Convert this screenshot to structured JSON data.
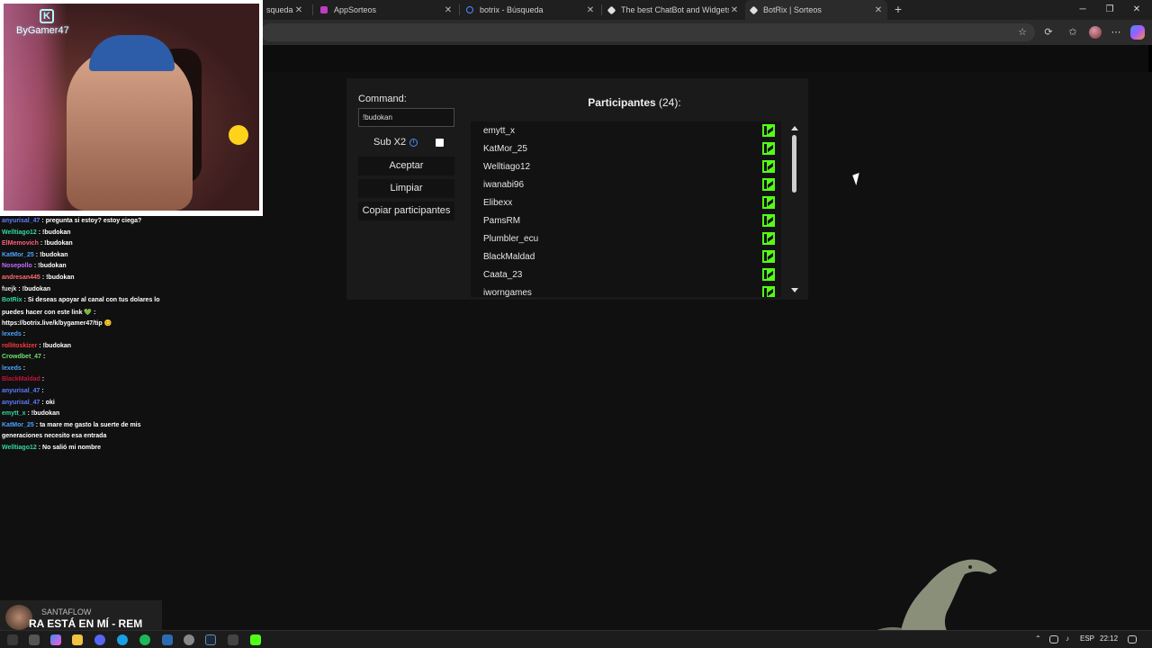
{
  "browser": {
    "tabs": [
      {
        "label": "squeda",
        "favicon_color": "#4c8dff"
      },
      {
        "label": "AppSorteos",
        "favicon_color": "#c03cc4"
      },
      {
        "label": "botrix - Búsqueda",
        "favicon_color": "#4c8dff"
      },
      {
        "label": "The best ChatBot and Widgets fo",
        "favicon_color": "#e0e0e0"
      },
      {
        "label": "BotRix | Sorteos",
        "favicon_color": "#e0e0e0"
      }
    ],
    "tab_close_glyph": "✕",
    "new_tab_glyph": "+"
  },
  "giveaway": {
    "command_label": "Command:",
    "command_value": "!budokan",
    "sub_x2_label": "Sub X2",
    "info_glyph": "i",
    "buttons": {
      "accept": "Aceptar",
      "clear": "Limpiar",
      "copy": "Copiar participantes"
    },
    "participants_title": "Participantes",
    "participants_count": "(24):",
    "participants": [
      "emytt_x",
      "KatMor_25",
      "Welltiago12",
      "iwanabi96",
      "Elibexx",
      "PamsRM",
      "Plumbler_ecu",
      "BlackMaldad",
      "Caata_23",
      "iworngames"
    ],
    "platform_icon": "kick-icon",
    "kick_color": "#53fc18"
  },
  "webcam": {
    "channel_tag": "ByGamer47"
  },
  "chat": {
    "lines": [
      {
        "user": "anyurisal_47",
        "color": "#5b7cff",
        "text": ": pregunta si estoy? estoy ciega?"
      },
      {
        "user": "Welltiago12",
        "color": "#35d6a0",
        "text": ": !budokan"
      },
      {
        "user": "ElMemovich",
        "color": "#ff5f7a",
        "text": ": !budokan"
      },
      {
        "user": "KatMor_25",
        "color": "#4aa3ff",
        "text": ": !budokan"
      },
      {
        "user": "Nosepollo",
        "color": "#c06cff",
        "text": ": !budokan"
      },
      {
        "user": "andresan445",
        "color": "#ff6b6b",
        "text": ": !budokan"
      },
      {
        "user": "fuejk",
        "color": "#e0e0e0",
        "text": ": !budokan"
      },
      {
        "user": "BotRix",
        "color": "#35d6a0",
        "text": ": Si deseas apoyar al canal con tus dolares lo"
      },
      {
        "user": "",
        "color": "#ffffff",
        "text": "puedes hacer con este link 💚 :"
      },
      {
        "user": "",
        "color": "#ffffff",
        "text": "https://botrix.live/k/bygamer47/tip 😊"
      },
      {
        "user": "lexeds",
        "color": "#4aa3ff",
        "text": ":"
      },
      {
        "user": "rollitoskizer",
        "color": "#ff3a3a",
        "text": ": !budokan"
      },
      {
        "user": "Crowdbet_47",
        "color": "#6fe06f",
        "text": ":"
      },
      {
        "user": "lexeds",
        "color": "#4aa3ff",
        "text": ":"
      },
      {
        "user": "BlackMaldad",
        "color": "#c0143c",
        "text": ":"
      },
      {
        "user": "anyurisal_47",
        "color": "#5b7cff",
        "text": ":"
      },
      {
        "user": "anyurisal_47",
        "color": "#5b7cff",
        "text": ": oki"
      },
      {
        "user": "emytt_x",
        "color": "#35d6a0",
        "text": ": !budokan"
      },
      {
        "user": "KatMor_25",
        "color": "#4aa3ff",
        "text": ": ta mare me gasto la suerte de mis"
      },
      {
        "user": "",
        "color": "#ffffff",
        "text": "generaciones necesito esa entrada"
      },
      {
        "user": "Welltiago12",
        "color": "#35d6a0",
        "text": ": No salió mi nombre"
      }
    ]
  },
  "now_playing": {
    "artist": "SANTAFLOW",
    "title": "RA ESTÁ EN MÍ - REM"
  },
  "taskbar": {
    "language": "ESP",
    "time": "22:12"
  }
}
